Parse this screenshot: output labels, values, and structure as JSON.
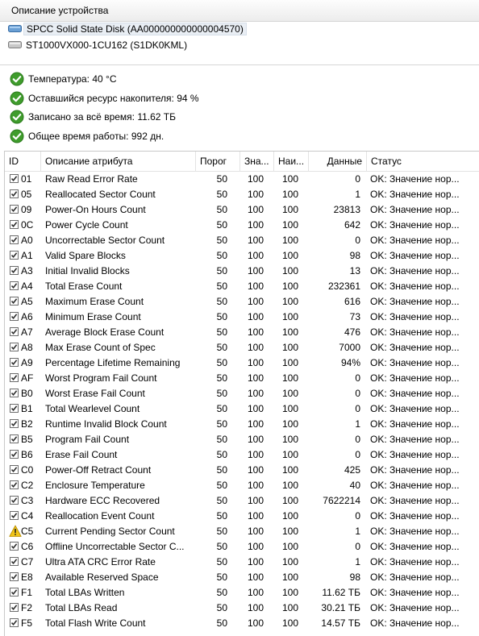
{
  "header": {
    "title": "Описание устройства"
  },
  "devices": [
    {
      "label": "SPCC Solid State Disk (AA000000000000004570)",
      "selected": true
    },
    {
      "label": "ST1000VX000-1CU162 (S1DK0KML)",
      "selected": false
    }
  ],
  "summary": [
    {
      "icon": "ok-icon",
      "text": "Температура: 40 °C"
    },
    {
      "icon": "ok-icon",
      "text": "Оставшийся ресурс накопителя: 94 %"
    },
    {
      "icon": "ok-icon",
      "text": "Записано за всё время: 11.62 ТБ"
    },
    {
      "icon": "ok-icon",
      "text": "Общее время работы: 992 дн."
    }
  ],
  "table": {
    "headers": {
      "id": "ID",
      "desc": "Описание атрибута",
      "threshold": "Порог",
      "value": "Зна...",
      "worst": "Наи...",
      "data": "Данные",
      "status": "Статус"
    },
    "rows": [
      {
        "id": "01",
        "desc": "Raw Read Error Rate",
        "threshold": "50",
        "value": "100",
        "worst": "100",
        "data": "0",
        "status": "OK: Значение нор...",
        "icon": "check"
      },
      {
        "id": "05",
        "desc": "Reallocated Sector Count",
        "threshold": "50",
        "value": "100",
        "worst": "100",
        "data": "1",
        "status": "OK: Значение нор...",
        "icon": "check"
      },
      {
        "id": "09",
        "desc": "Power-On Hours Count",
        "threshold": "50",
        "value": "100",
        "worst": "100",
        "data": "23813",
        "status": "OK: Значение нор...",
        "icon": "check"
      },
      {
        "id": "0C",
        "desc": "Power Cycle Count",
        "threshold": "50",
        "value": "100",
        "worst": "100",
        "data": "642",
        "status": "OK: Значение нор...",
        "icon": "check"
      },
      {
        "id": "A0",
        "desc": "Uncorrectable Sector Count",
        "threshold": "50",
        "value": "100",
        "worst": "100",
        "data": "0",
        "status": "OK: Значение нор...",
        "icon": "check"
      },
      {
        "id": "A1",
        "desc": "Valid Spare Blocks",
        "threshold": "50",
        "value": "100",
        "worst": "100",
        "data": "98",
        "status": "OK: Значение нор...",
        "icon": "check"
      },
      {
        "id": "A3",
        "desc": "Initial Invalid Blocks",
        "threshold": "50",
        "value": "100",
        "worst": "100",
        "data": "13",
        "status": "OK: Значение нор...",
        "icon": "check"
      },
      {
        "id": "A4",
        "desc": "Total Erase Count",
        "threshold": "50",
        "value": "100",
        "worst": "100",
        "data": "232361",
        "status": "OK: Значение нор...",
        "icon": "check"
      },
      {
        "id": "A5",
        "desc": "Maximum Erase Count",
        "threshold": "50",
        "value": "100",
        "worst": "100",
        "data": "616",
        "status": "OK: Значение нор...",
        "icon": "check"
      },
      {
        "id": "A6",
        "desc": "Minimum Erase Count",
        "threshold": "50",
        "value": "100",
        "worst": "100",
        "data": "73",
        "status": "OK: Значение нор...",
        "icon": "check"
      },
      {
        "id": "A7",
        "desc": "Average Block Erase Count",
        "threshold": "50",
        "value": "100",
        "worst": "100",
        "data": "476",
        "status": "OK: Значение нор...",
        "icon": "check"
      },
      {
        "id": "A8",
        "desc": "Max Erase Count of Spec",
        "threshold": "50",
        "value": "100",
        "worst": "100",
        "data": "7000",
        "status": "OK: Значение нор...",
        "icon": "check"
      },
      {
        "id": "A9",
        "desc": "Percentage Lifetime Remaining",
        "threshold": "50",
        "value": "100",
        "worst": "100",
        "data": "94%",
        "status": "OK: Значение нор...",
        "icon": "check"
      },
      {
        "id": "AF",
        "desc": "Worst Program Fail Count",
        "threshold": "50",
        "value": "100",
        "worst": "100",
        "data": "0",
        "status": "OK: Значение нор...",
        "icon": "check"
      },
      {
        "id": "B0",
        "desc": "Worst Erase Fail Count",
        "threshold": "50",
        "value": "100",
        "worst": "100",
        "data": "0",
        "status": "OK: Значение нор...",
        "icon": "check"
      },
      {
        "id": "B1",
        "desc": "Total Wearlevel Count",
        "threshold": "50",
        "value": "100",
        "worst": "100",
        "data": "0",
        "status": "OK: Значение нор...",
        "icon": "check"
      },
      {
        "id": "B2",
        "desc": "Runtime Invalid Block Count",
        "threshold": "50",
        "value": "100",
        "worst": "100",
        "data": "1",
        "status": "OK: Значение нор...",
        "icon": "check"
      },
      {
        "id": "B5",
        "desc": "Program Fail Count",
        "threshold": "50",
        "value": "100",
        "worst": "100",
        "data": "0",
        "status": "OK: Значение нор...",
        "icon": "check"
      },
      {
        "id": "B6",
        "desc": "Erase Fail Count",
        "threshold": "50",
        "value": "100",
        "worst": "100",
        "data": "0",
        "status": "OK: Значение нор...",
        "icon": "check"
      },
      {
        "id": "C0",
        "desc": "Power-Off Retract Count",
        "threshold": "50",
        "value": "100",
        "worst": "100",
        "data": "425",
        "status": "OK: Значение нор...",
        "icon": "check"
      },
      {
        "id": "C2",
        "desc": "Enclosure Temperature",
        "threshold": "50",
        "value": "100",
        "worst": "100",
        "data": "40",
        "status": "OK: Значение нор...",
        "icon": "check"
      },
      {
        "id": "C3",
        "desc": "Hardware ECC Recovered",
        "threshold": "50",
        "value": "100",
        "worst": "100",
        "data": "7622214",
        "status": "OK: Значение нор...",
        "icon": "check"
      },
      {
        "id": "C4",
        "desc": "Reallocation Event Count",
        "threshold": "50",
        "value": "100",
        "worst": "100",
        "data": "0",
        "status": "OK: Значение нор...",
        "icon": "check"
      },
      {
        "id": "C5",
        "desc": "Current Pending Sector Count",
        "threshold": "50",
        "value": "100",
        "worst": "100",
        "data": "1",
        "status": "OK: Значение нор...",
        "icon": "warning"
      },
      {
        "id": "C6",
        "desc": "Offline Uncorrectable Sector C...",
        "threshold": "50",
        "value": "100",
        "worst": "100",
        "data": "0",
        "status": "OK: Значение нор...",
        "icon": "check"
      },
      {
        "id": "C7",
        "desc": "Ultra ATA CRC Error Rate",
        "threshold": "50",
        "value": "100",
        "worst": "100",
        "data": "1",
        "status": "OK: Значение нор...",
        "icon": "check"
      },
      {
        "id": "E8",
        "desc": "Available Reserved Space",
        "threshold": "50",
        "value": "100",
        "worst": "100",
        "data": "98",
        "status": "OK: Значение нор...",
        "icon": "check"
      },
      {
        "id": "F1",
        "desc": "Total LBAs Written",
        "threshold": "50",
        "value": "100",
        "worst": "100",
        "data": "11.62 ТБ",
        "status": "OK: Значение нор...",
        "icon": "check"
      },
      {
        "id": "F2",
        "desc": "Total LBAs Read",
        "threshold": "50",
        "value": "100",
        "worst": "100",
        "data": "30.21 ТБ",
        "status": "OK: Значение нор...",
        "icon": "check"
      },
      {
        "id": "F5",
        "desc": "Total Flash Write Count",
        "threshold": "50",
        "value": "100",
        "worst": "100",
        "data": "14.57 ТБ",
        "status": "OK: Значение нор...",
        "icon": "check"
      }
    ]
  },
  "colors": {
    "ok": "#3f9c2c",
    "warning": "#f0c419",
    "selection": "#e9eef4"
  }
}
